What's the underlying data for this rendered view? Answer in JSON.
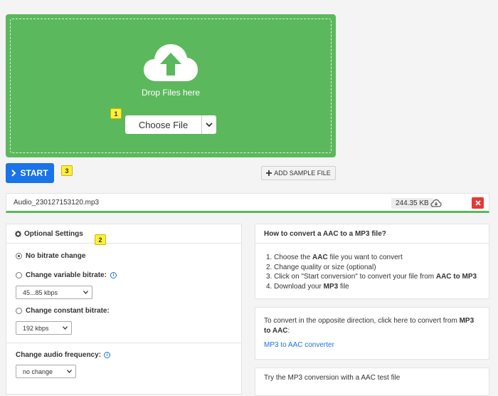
{
  "dropzone": {
    "text": "Drop Files here",
    "choose_label": "Choose File",
    "color": "#5cb85c"
  },
  "badges": {
    "b1": "1",
    "b2": "2",
    "b3": "3"
  },
  "actions": {
    "start_label": "START",
    "sample_label": "ADD SAMPLE FILE",
    "accent": "#1a73e8"
  },
  "file": {
    "name": "Audio_230127153120.mp3",
    "size": "244.35 KB"
  },
  "settings": {
    "title": "Optional Settings",
    "no_bitrate": "No bitrate change",
    "variable_bitrate": "Change variable bitrate:",
    "variable_value": "45...85 kbps",
    "constant_bitrate": "Change constant bitrate:",
    "constant_value": "192 kbps",
    "frequency_label": "Change audio frequency:",
    "frequency_value": "no change"
  },
  "howto": {
    "title": "How to convert a AAC to a MP3 file?",
    "step1_pre": "1. Choose the ",
    "step1_bold": "AAC",
    "step1_post": " file you want to convert",
    "step2": "2. Change quality or size (optional)",
    "step3_pre": "3. Click on \"Start conversion\" to convert your file from ",
    "step3_bold": "AAC to MP3",
    "step4_pre": "4. Download your ",
    "step4_bold": "MP3",
    "step4_post": " file"
  },
  "opposite": {
    "text_pre": "To convert in the opposite direction, click here to convert from ",
    "text_bold": "MP3 to AAC",
    "text_post": ":",
    "link": "MP3 to AAC converter"
  },
  "try_test": "Try the MP3 conversion with a AAC test file"
}
